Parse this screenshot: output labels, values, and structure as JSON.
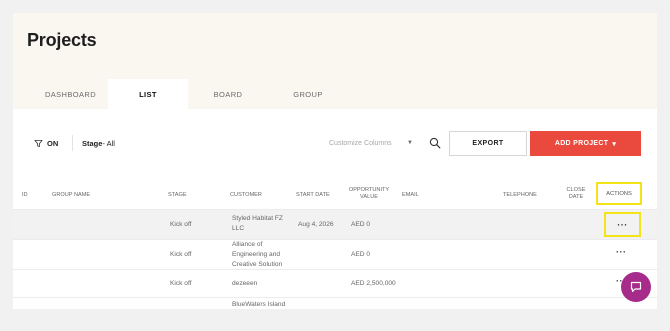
{
  "header": {
    "title": "Projects"
  },
  "tabs": [
    {
      "label": "DASHBOARD",
      "active": false
    },
    {
      "label": "LIST",
      "active": true
    },
    {
      "label": "BOARD",
      "active": false
    },
    {
      "label": "GROUP",
      "active": false
    }
  ],
  "toolbar": {
    "filter_toggle": "ON",
    "stage_label": "Stage",
    "stage_value": "- All",
    "customize_columns": "Customize Columns",
    "export_label": "EXPORT",
    "add_project_label": "ADD PROJECT",
    "add_project_caret": "▾",
    "accent_color": "#ea4a3d"
  },
  "table": {
    "columns": {
      "id": "ID",
      "group_name": "GROUP NAME",
      "stage": "STAGE",
      "customer": "CUSTOMER",
      "start_date": "START DATE",
      "opportunity_value_1": "OPPORTUNITY",
      "opportunity_value_2": "VALUE",
      "email": "EMAIL",
      "telephone": "TELEPHONE",
      "close_date_1": "CLOSE",
      "close_date_2": "DATE",
      "actions": "ACTIONS"
    },
    "rows": [
      {
        "stage": "Kick off",
        "customer_1": "Styled Habitat FZ",
        "customer_2": "LLC",
        "customer_3": "",
        "start_date": "Aug 4, 2026",
        "value": "AED 0",
        "actions": "···"
      },
      {
        "stage": "Kick off",
        "customer_1": "Alliance of",
        "customer_2": "Engineering and",
        "customer_3": "Creative Solution",
        "start_date": "",
        "value": "AED 0",
        "actions": "···"
      },
      {
        "stage": "Kick off",
        "customer_1": "dezeeen",
        "customer_2": "",
        "customer_3": "",
        "start_date": "",
        "value": "AED 2,500,000",
        "actions": "···"
      },
      {
        "stage": "",
        "customer_1": "BlueWaters Island",
        "customer_2": "",
        "customer_3": "",
        "start_date": "",
        "value": "",
        "actions": ""
      }
    ]
  },
  "chat": {
    "icon": "chat-bubble-icon",
    "color": "#a62b8a"
  }
}
